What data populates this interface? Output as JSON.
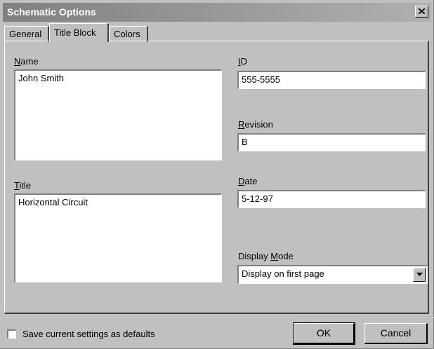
{
  "window": {
    "title": "Schematic Options"
  },
  "tabs": [
    {
      "label": "General"
    },
    {
      "label": "Title Block",
      "active": true
    },
    {
      "label": "Colors"
    }
  ],
  "fields": {
    "name": {
      "label_pre": "",
      "label_ul": "N",
      "label_post": "ame",
      "value": "John Smith"
    },
    "title": {
      "label_pre": "",
      "label_ul": "T",
      "label_post": "itle",
      "value": "Horizontal Circuit"
    },
    "id": {
      "label_pre": "",
      "label_ul": "I",
      "label_post": "D",
      "value": "555-5555"
    },
    "revision": {
      "label_pre": "",
      "label_ul": "R",
      "label_post": "evision",
      "value": "B"
    },
    "date": {
      "label_pre": "",
      "label_ul": "D",
      "label_post": "ate",
      "value": "5-12-97"
    },
    "display_mode": {
      "label_pre": "Display ",
      "label_ul": "M",
      "label_post": "ode",
      "value": "Display on first page"
    }
  },
  "footer": {
    "save_defaults_label": "Save current settings as defaults",
    "save_defaults_checked": false,
    "ok_label": "OK",
    "cancel_label": "Cancel"
  },
  "colors": {
    "title_bar_start": "#808080",
    "title_bar_end": "#b0b0b0",
    "dialog_bg": "#c0c0c0"
  }
}
